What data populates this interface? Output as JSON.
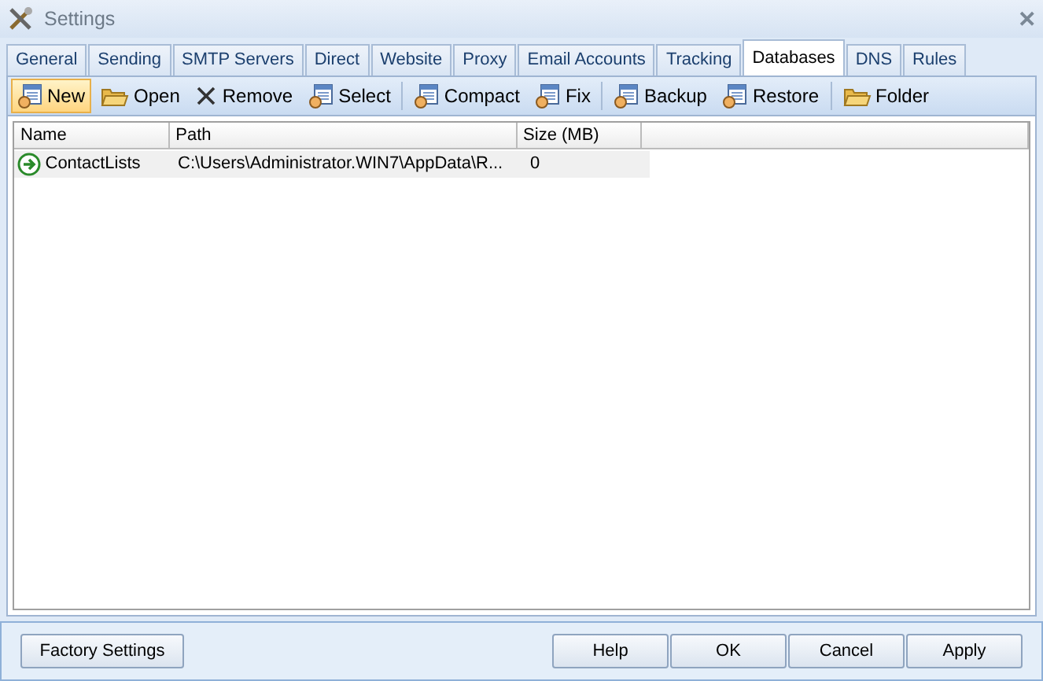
{
  "window": {
    "title": "Settings",
    "close_glyph": "✕"
  },
  "tabs": [
    {
      "label": "General",
      "selected": false
    },
    {
      "label": "Sending",
      "selected": false
    },
    {
      "label": "SMTP Servers",
      "selected": false
    },
    {
      "label": "Direct",
      "selected": false
    },
    {
      "label": "Website",
      "selected": false
    },
    {
      "label": "Proxy",
      "selected": false
    },
    {
      "label": "Email Accounts",
      "selected": false
    },
    {
      "label": "Tracking",
      "selected": false
    },
    {
      "label": "Databases",
      "selected": true
    },
    {
      "label": "DNS",
      "selected": false
    },
    {
      "label": "Rules",
      "selected": false
    }
  ],
  "toolbar": [
    {
      "label": "New",
      "kind": "database",
      "highlighted": true,
      "separator_after": false
    },
    {
      "label": "Open",
      "kind": "folder",
      "highlighted": false,
      "separator_after": false
    },
    {
      "label": "Remove",
      "kind": "remove",
      "highlighted": false,
      "separator_after": false
    },
    {
      "label": "Select",
      "kind": "database",
      "highlighted": false,
      "separator_after": true
    },
    {
      "label": "Compact",
      "kind": "database",
      "highlighted": false,
      "separator_after": false
    },
    {
      "label": "Fix",
      "kind": "database",
      "highlighted": false,
      "separator_after": true
    },
    {
      "label": "Backup",
      "kind": "database",
      "highlighted": false,
      "separator_after": false
    },
    {
      "label": "Restore",
      "kind": "database",
      "highlighted": false,
      "separator_after": true
    },
    {
      "label": "Folder",
      "kind": "folder",
      "highlighted": false,
      "separator_after": false
    }
  ],
  "table": {
    "columns": [
      "Name",
      "Path",
      "Size (MB)"
    ],
    "rows": [
      {
        "name": "ContactLists",
        "path": "C:\\Users\\Administrator.WIN7\\AppData\\R...",
        "size": "0"
      }
    ]
  },
  "footer": {
    "left_button": "Factory Settings",
    "buttons": [
      "Help",
      "OK",
      "Cancel",
      "Apply"
    ]
  }
}
